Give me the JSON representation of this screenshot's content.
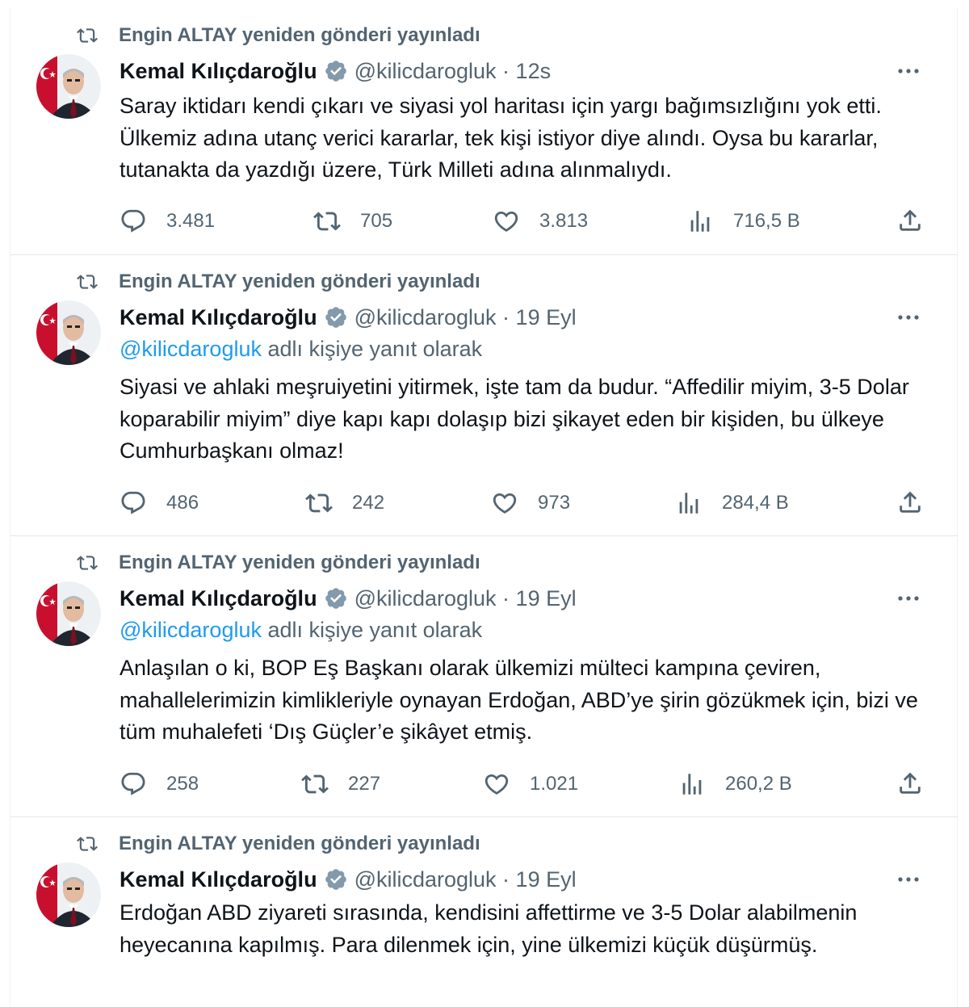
{
  "retweet_label": "Engin ALTAY yeniden gönderi yayınladı",
  "author": {
    "name": "Kemal Kılıçdaroğlu",
    "handle": "@kilicdarogluk"
  },
  "reply_link": "@kilicdarogluk",
  "reply_suffix": " adlı kişiye yanıt olarak",
  "colors": {
    "accent": "#1d9bf0",
    "muted": "#536471",
    "text": "#0f1419"
  },
  "tweets": [
    {
      "time": "12s",
      "text": "Saray iktidarı kendi çıkarı ve siyasi yol haritası için yargı bağımsızlığını yok etti. Ülkemiz adına utanç verici kararlar, tek kişi istiyor diye alındı. Oysa bu kararlar, tutanakta da yazdığı üzere, Türk Milleti adına alınmalıydı.",
      "replies": "3.481",
      "retweets": "705",
      "likes": "3.813",
      "views": "716,5 B"
    },
    {
      "time": "19 Eyl",
      "text": "Siyasi ve ahlaki meşruiyetini yitirmek, işte tam da budur. “Affedilir miyim, 3-5 Dolar koparabilir miyim” diye kapı kapı dolaşıp bizi şikayet eden bir kişiden, bu ülkeye Cumhurbaşkanı olmaz!",
      "replies": "486",
      "retweets": "242",
      "likes": "973",
      "views": "284,4 B"
    },
    {
      "time": "19 Eyl",
      "text": "Anlaşılan o ki, BOP Eş Başkanı olarak ülkemizi mülteci kampına çeviren, mahallelerimizin kimlikleriyle oynayan Erdoğan, ABD’ye şirin gözükmek için, bizi ve tüm muhalefeti ‘Dış Güçler’e şikâyet etmiş.",
      "replies": "258",
      "retweets": "227",
      "likes": "1.021",
      "views": "260,2 B"
    },
    {
      "time": "19 Eyl",
      "text": "Erdoğan ABD ziyareti sırasında, kendisini affettirme ve 3-5 Dolar alabilmenin heyecanına kapılmış. Para dilenmek için, yine ülkemizi küçük düşürmüş."
    }
  ]
}
